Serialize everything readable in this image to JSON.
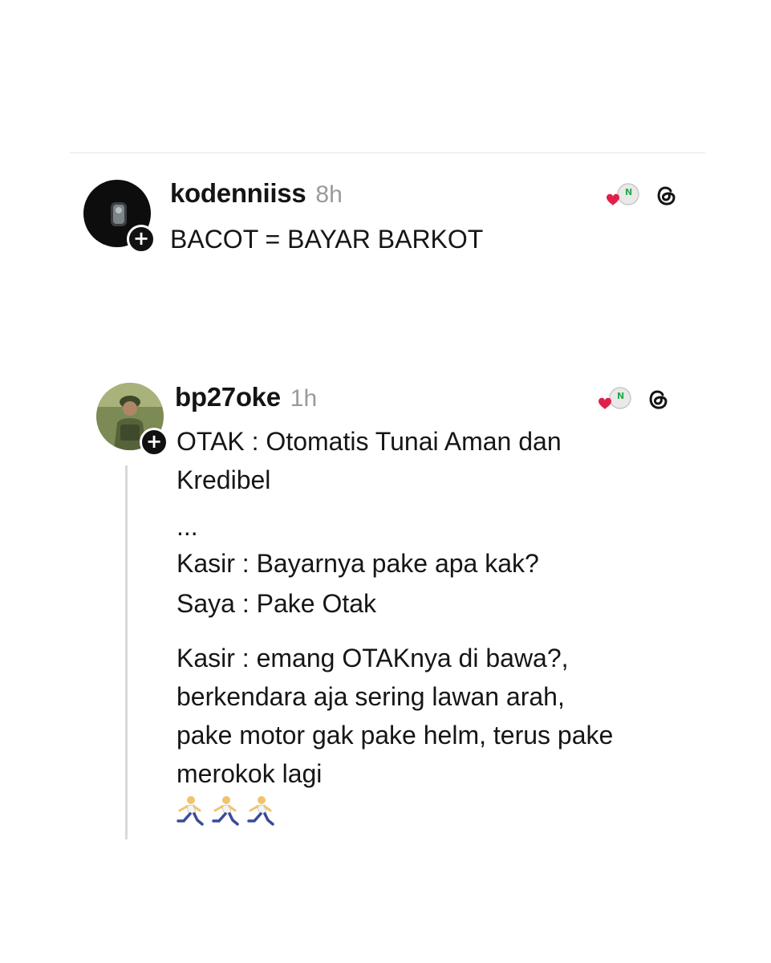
{
  "posts": [
    {
      "username": "kodenniiss",
      "time": "8h",
      "follow_symbol": "+",
      "text": "BACOT = BAYAR BARKOT",
      "avatar_icon": "dark-portrait-avatar",
      "sticker_icon": "heart-badge-sticker",
      "platform_icon": "threads-icon"
    },
    {
      "username": "bp27oke",
      "time": "1h",
      "follow_symbol": "+",
      "lines": [
        "OTAK : Otomatis Tunai Aman dan\nKredibel",
        "...",
        "Kasir : Bayarnya pake apa kak?",
        "Saya : Pake Otak",
        "Kasir : emang OTAKnya di bawa?,\nberkendara aja sering lawan arah,\npake motor gak pake helm, terus pake\nmerokok lagi"
      ],
      "emoji_icons": [
        "running-person-icon",
        "running-person-icon",
        "running-person-icon"
      ],
      "avatar_icon": "soldier-portrait-avatar",
      "sticker_icon": "heart-badge-sticker",
      "platform_icon": "threads-icon"
    }
  ],
  "colors": {
    "text": "#161616",
    "muted": "#9a9a9a",
    "heart": "#e0204a",
    "badge_green": "#2aa84a",
    "divider": "#e6e6e6"
  }
}
